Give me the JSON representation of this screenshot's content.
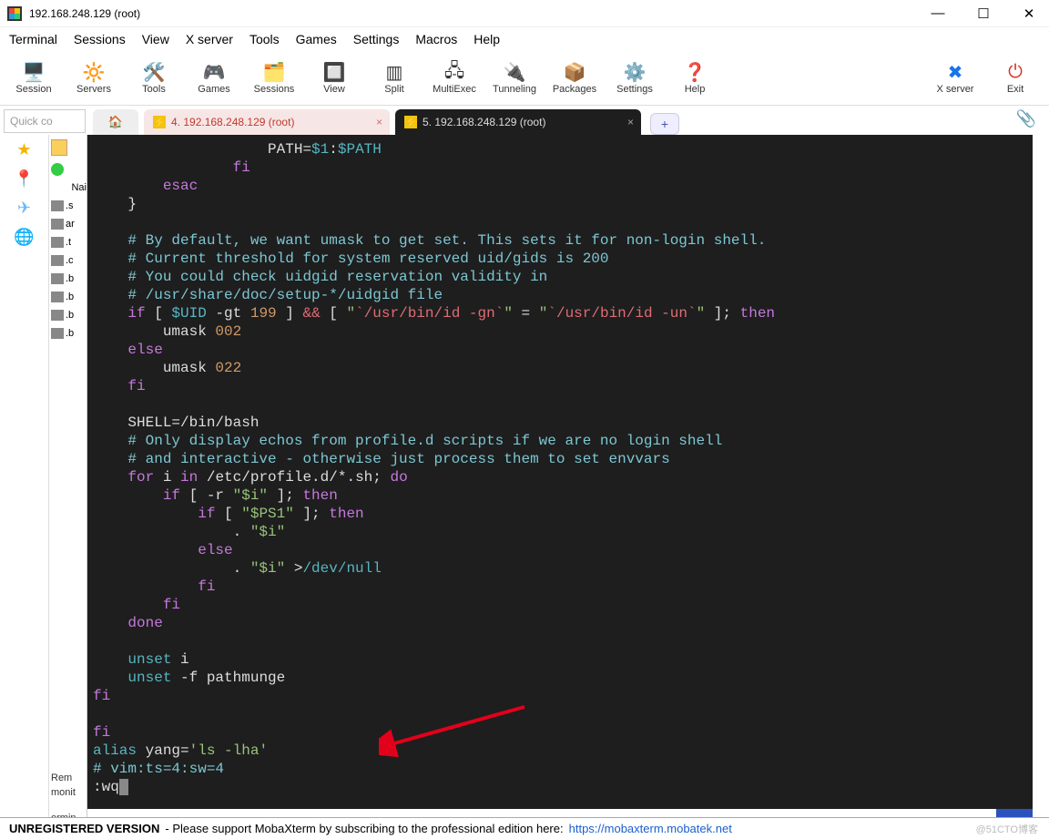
{
  "window": {
    "title": "192.168.248.129 (root)"
  },
  "menu": [
    "Terminal",
    "Sessions",
    "View",
    "X server",
    "Tools",
    "Games",
    "Settings",
    "Macros",
    "Help"
  ],
  "toolbar": [
    {
      "label": "Session",
      "icon": "🖥️",
      "name": "session-button"
    },
    {
      "label": "Servers",
      "icon": "🔆",
      "name": "servers-button"
    },
    {
      "label": "Tools",
      "icon": "🛠️",
      "name": "tools-button"
    },
    {
      "label": "Games",
      "icon": "🎮",
      "name": "games-button"
    },
    {
      "label": "Sessions",
      "icon": "🗂️",
      "name": "sessions-button"
    },
    {
      "label": "View",
      "icon": "🔲",
      "name": "view-button"
    },
    {
      "label": "Split",
      "icon": "▥",
      "name": "split-button"
    },
    {
      "label": "MultiExec",
      "icon": "🖧",
      "name": "multiexec-button"
    },
    {
      "label": "Tunneling",
      "icon": "🔌",
      "name": "tunneling-button"
    },
    {
      "label": "Packages",
      "icon": "📦",
      "name": "packages-button"
    },
    {
      "label": "Settings",
      "icon": "⚙️",
      "name": "settings-button"
    },
    {
      "label": "Help",
      "icon": "❓",
      "name": "help-button"
    }
  ],
  "toolbar_right": [
    {
      "label": "X server",
      "icon": "✖",
      "name": "xserver-button",
      "color": "#1a73e8"
    },
    {
      "label": "Exit",
      "icon": "⏻",
      "name": "exit-button",
      "color": "#d93025"
    }
  ],
  "quick": {
    "placeholder": "Quick co"
  },
  "tabs": {
    "t1": {
      "label": "4. 192.168.248.129 (root)"
    },
    "t2": {
      "label": "5. 192.168.248.129 (root)"
    }
  },
  "leftstrip": [
    {
      "icon": "★",
      "name": "favorites-icon",
      "color": "#f4b400"
    },
    {
      "icon": "📍",
      "name": "pin-icon",
      "color": "#d33"
    },
    {
      "icon": "✈",
      "name": "send-icon",
      "color": "#6ab7ff"
    },
    {
      "icon": "🌐",
      "name": "globe-icon",
      "color": "#f0932b"
    }
  ],
  "filepanel": {
    "header": "Nai",
    "items": [
      ".s",
      "ar",
      ".t",
      ".c",
      ".b",
      ".b",
      ".b",
      ".b"
    ],
    "bottom1": "Rem",
    "bottom2": "monit",
    "bottom3": "ermin"
  },
  "term": {
    "l1a": "                    PATH=",
    "l1b": "$1",
    "l1c": ":",
    "l1d": "$PATH",
    "l2": "                fi",
    "l3": "        esac",
    "l4": "    }",
    "c1": "    # By default, we want umask to get set. This sets it for non-login shell.",
    "c2": "    # Current threshold for system reserved uid/gids is 200",
    "c3": "    # You could check uidgid reservation validity in",
    "c4": "    # /usr/share/doc/setup-*/uidgid file",
    "if1a": "    if",
    "if1b": " [ ",
    "if1c": "$UID",
    "if1d": " -gt ",
    "if1e": "199",
    "if1f": " ] ",
    "amp": "&&",
    "if1g": " [ ",
    "q1": "\"",
    "bt1": "`/usr/bin/id -gn`",
    "q2": "\"",
    "eq": " = ",
    "q3": "\"",
    "bt2": "`/usr/bin/id -un`",
    "q4": "\"",
    "if1h": " ]; ",
    "then": "then",
    "um1": "        umask ",
    "um1v": "002",
    "else": "    else",
    "um2": "        umask ",
    "um2v": "022",
    "fi1": "    fi",
    "sh1": "    SHELL=/bin/bash",
    "c5": "    # Only display echos from profile.d scripts if we are no login shell",
    "c6": "    # and interactive - otherwise just process them to set envvars",
    "for1": "    for",
    "for2": " i ",
    "in": "in",
    "for3": " /etc/profile.d/*.sh; ",
    "do": "do",
    "if2a": "        if",
    "if2b": " [ -r ",
    "si": "\"$i\"",
    "if2c": " ]; ",
    "then2": "then",
    "if3a": "            if",
    "if3b": " [ ",
    "ps1": "\"$PS1\"",
    "if3c": " ]; ",
    "then3": "then",
    "dot1": "                . ",
    "si2": "\"$i\"",
    "else2": "            else",
    "dot2": "                . ",
    "si3": "\"$i\"",
    "red": " >",
    "devnull": "/dev/null",
    "fi2": "            fi",
    "fi3": "        fi",
    "done": "    done",
    "un1": "    unset",
    "un1b": " i",
    "un2": "    unset",
    "un2b": " -f pathmunge",
    "fi4": "fi",
    "fi5": "fi",
    "alias": "alias",
    "aliasb": " yang=",
    "aliasv": "'ls -lha'",
    "vimc": "# vim:ts=4:sw=4",
    "wq": ":wq"
  },
  "footer": {
    "unreg": "UNREGISTERED VERSION",
    "msg": "  -  Please support MobaXterm by subscribing to the professional edition here:  ",
    "link": "https://mobaxterm.mobatek.net",
    "watermark": "@51CTO博客"
  }
}
